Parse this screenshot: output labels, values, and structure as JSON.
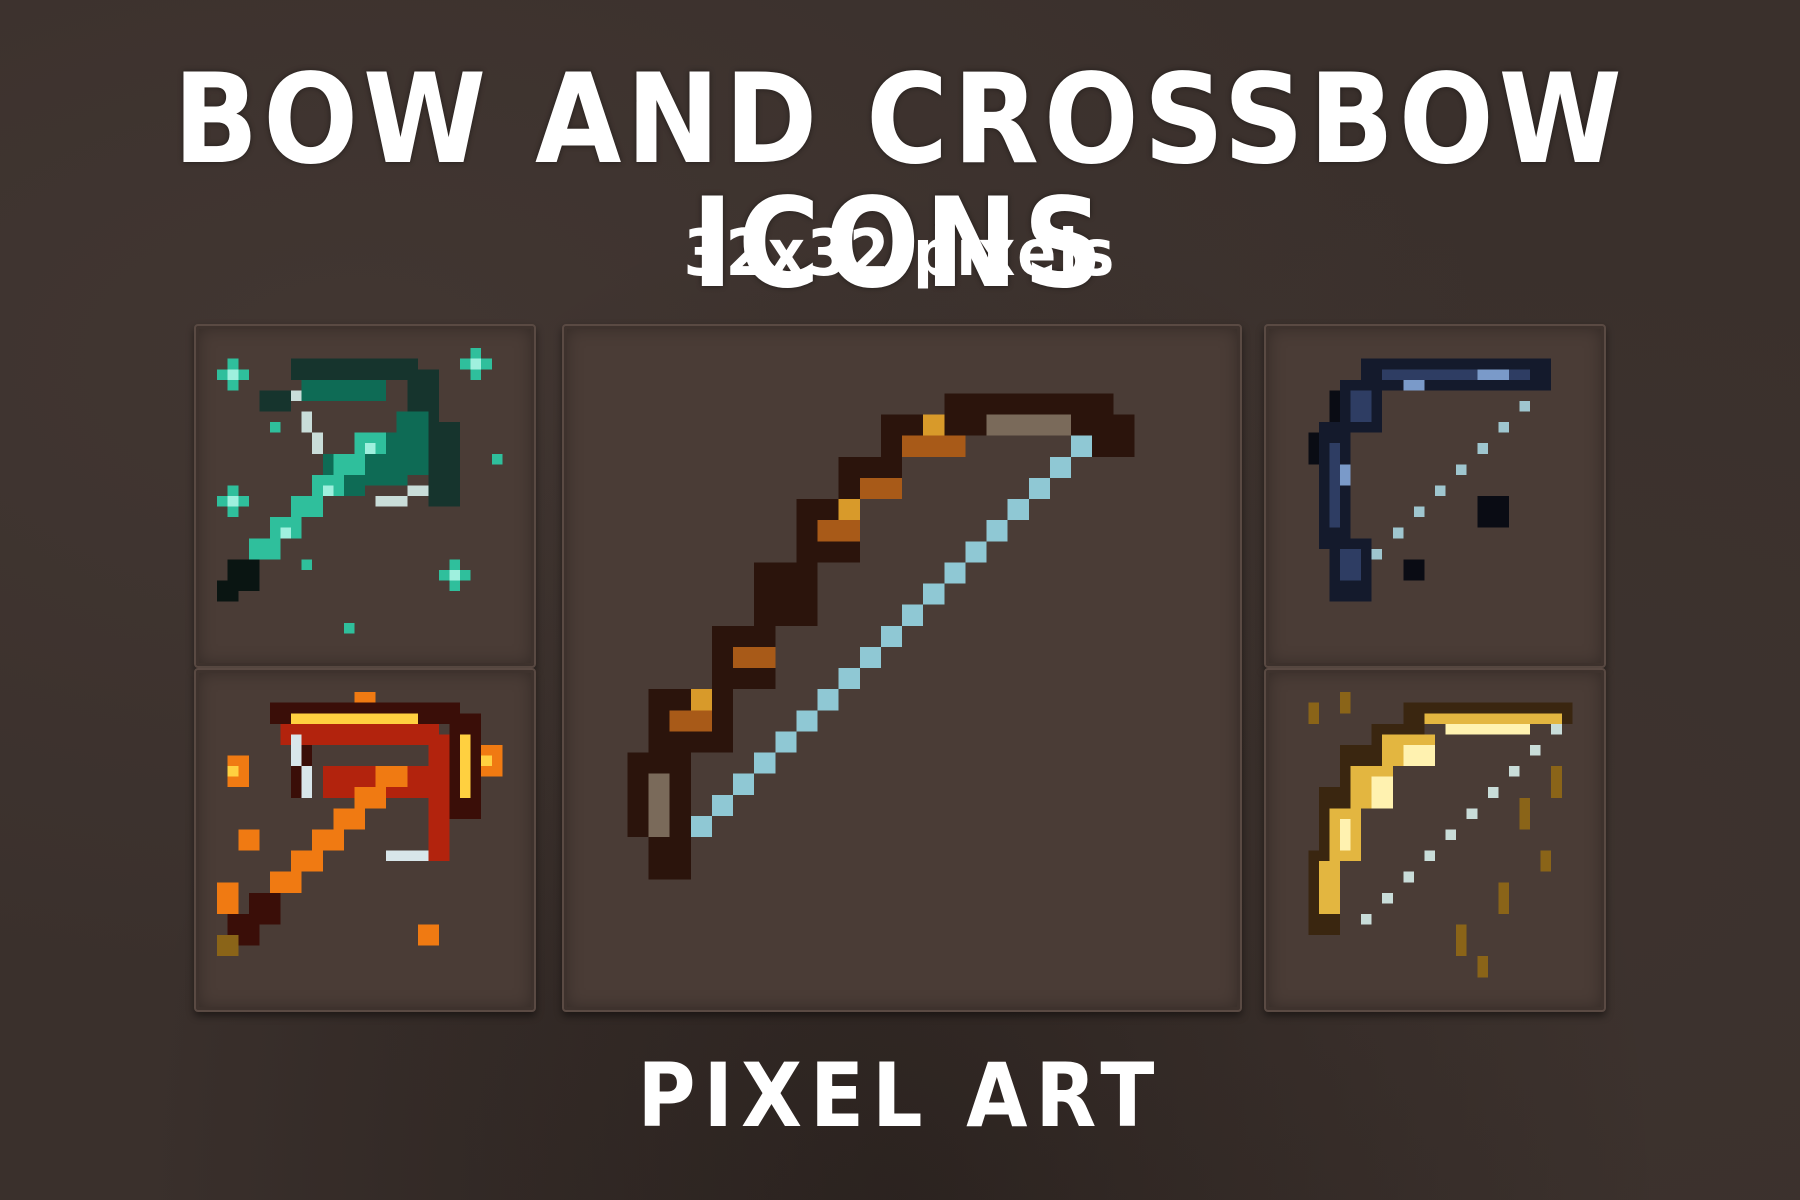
{
  "title": "BOW AND CROSSBOW ICONS",
  "subtitle": "32x32 pixels",
  "footer": "PIXEL ART",
  "icons": [
    {
      "name": "emerald-crossbow",
      "palette": [
        "#0e6b55",
        "#2fbf9c",
        "#9ff0de",
        "#16342d"
      ]
    },
    {
      "name": "fire-crossbow",
      "palette": [
        "#b2230d",
        "#f07a12",
        "#ffd040",
        "#3a0e08"
      ]
    },
    {
      "name": "wooden-bow",
      "palette": [
        "#2b140c",
        "#a85a18",
        "#d89a2a",
        "#8fc8d4"
      ]
    },
    {
      "name": "shadow-bow",
      "palette": [
        "#141a2c",
        "#2e3d63",
        "#7a9ac9",
        "#0a0c14"
      ]
    },
    {
      "name": "golden-bow",
      "palette": [
        "#8a6418",
        "#e3b640",
        "#fff2b0",
        "#3a2610"
      ]
    }
  ]
}
